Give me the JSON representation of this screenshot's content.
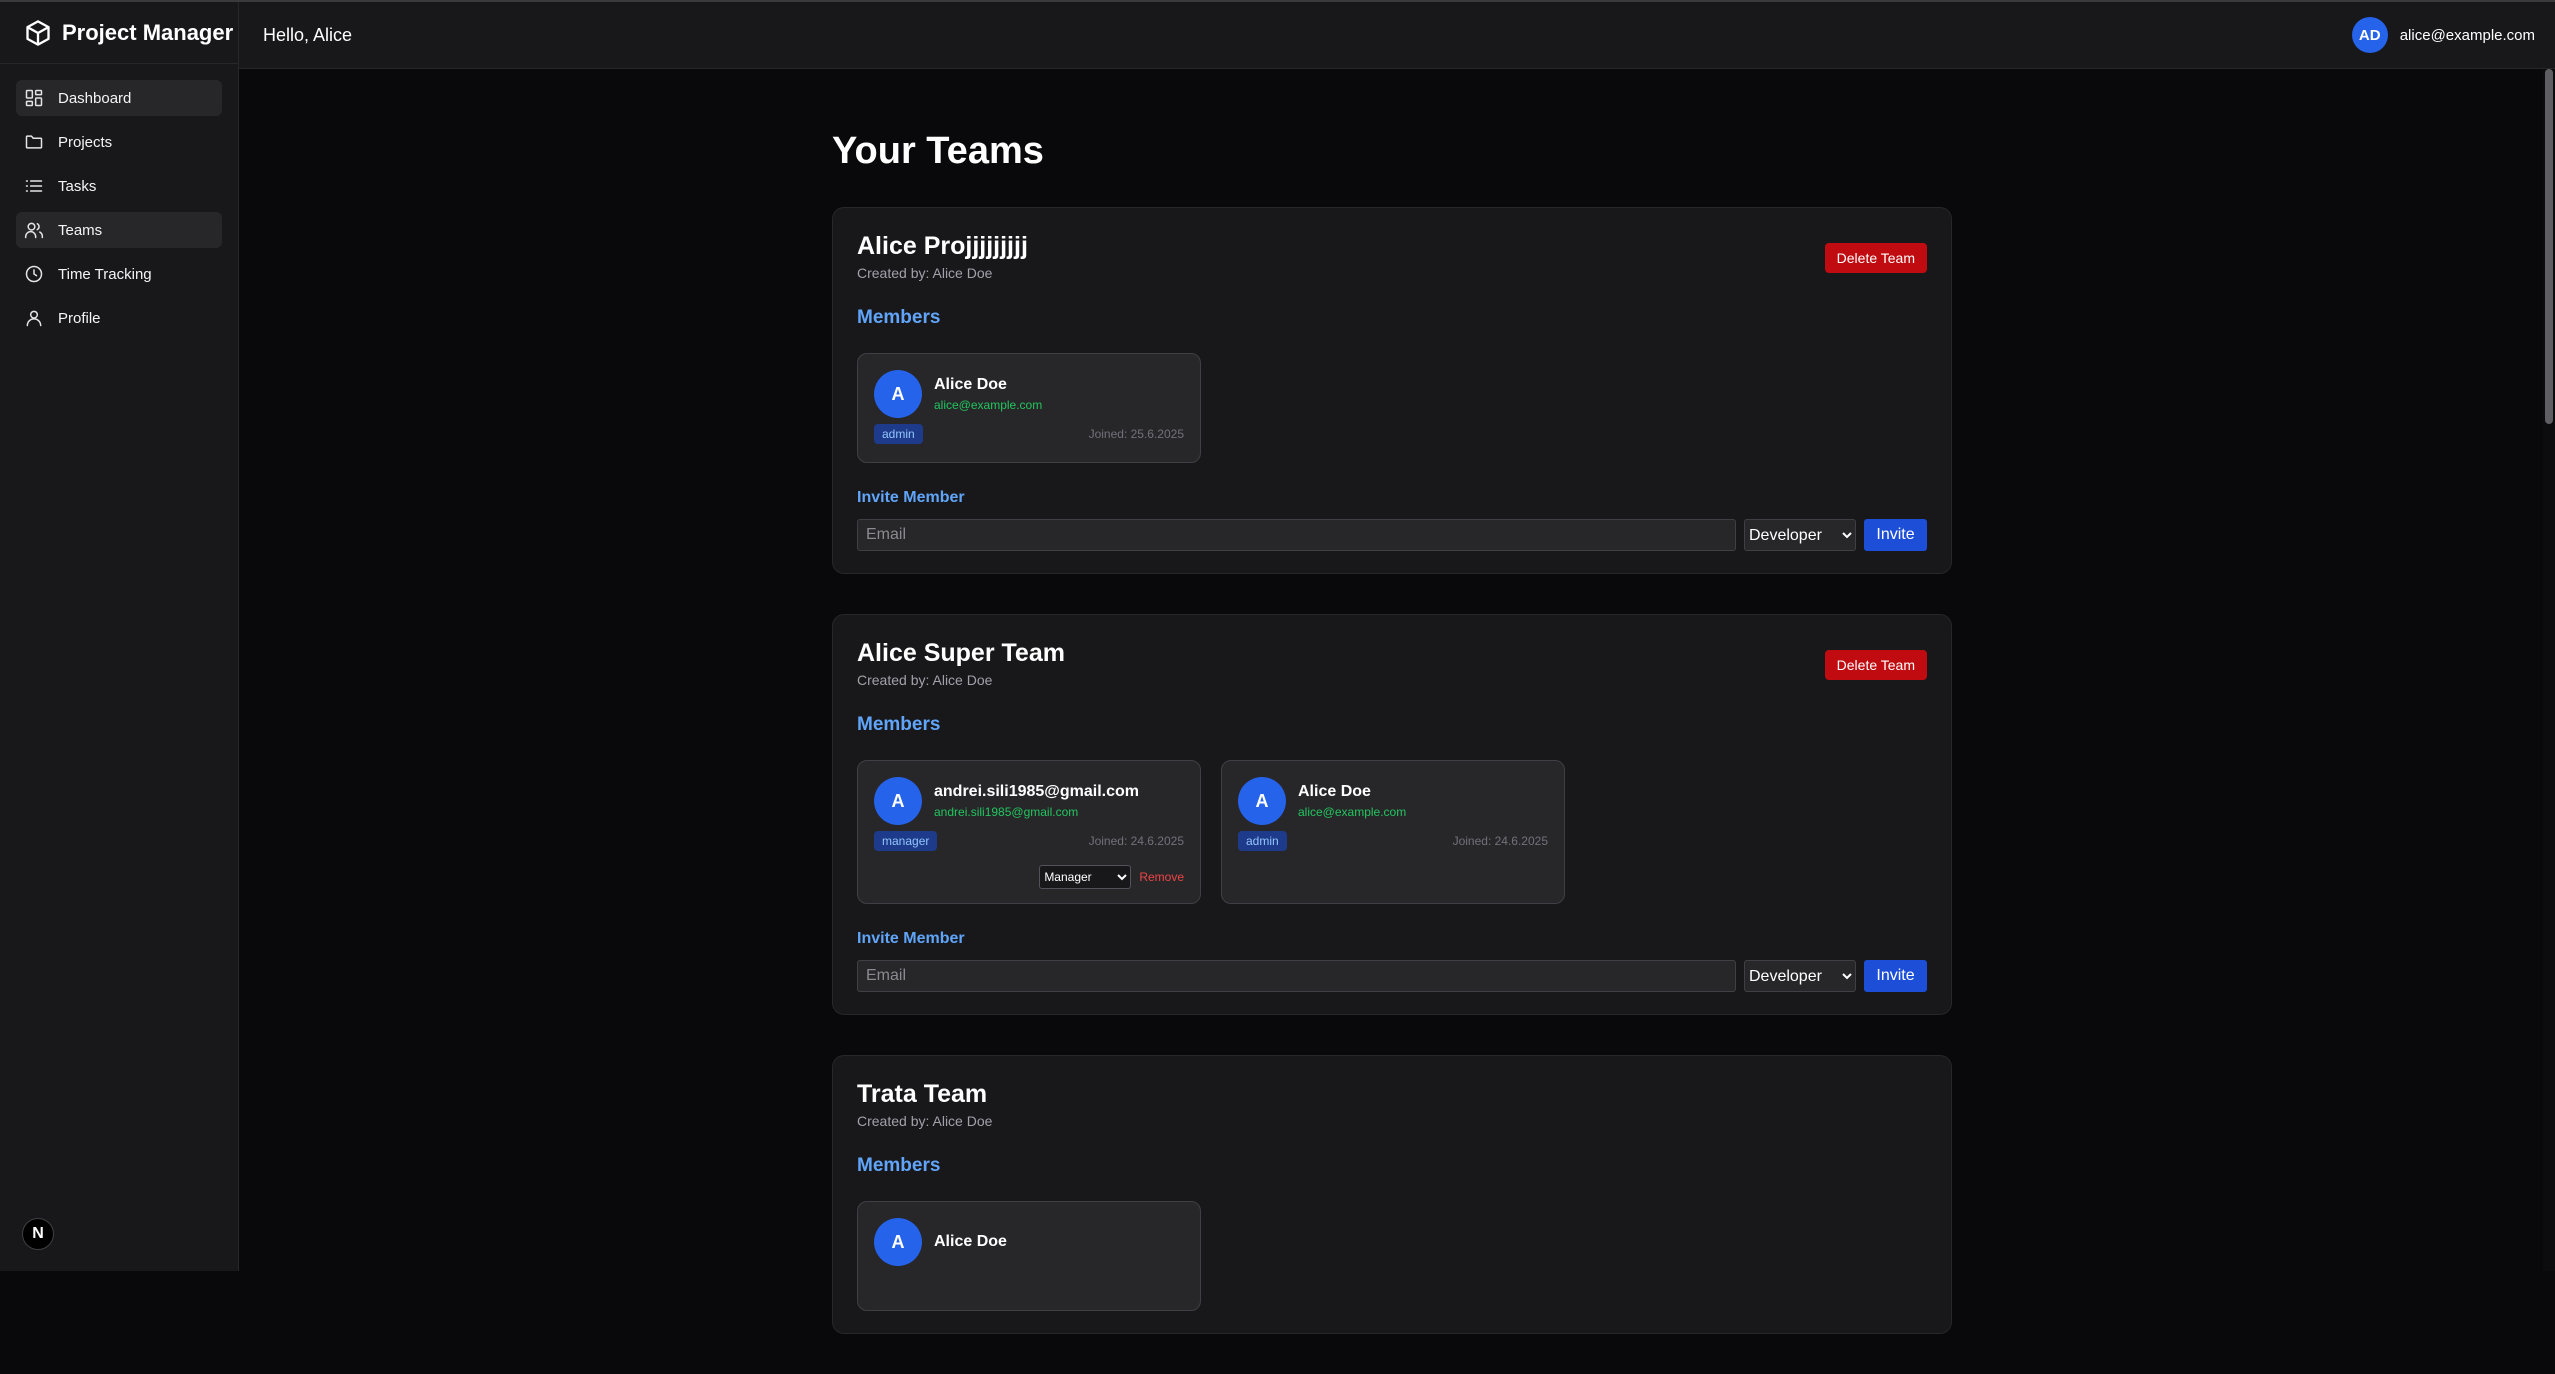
{
  "app": {
    "title": "Project Manager"
  },
  "sidebar": {
    "items": [
      {
        "label": "Dashboard",
        "icon": "dashboard-icon",
        "active": true
      },
      {
        "label": "Projects",
        "icon": "folder-icon",
        "active": false
      },
      {
        "label": "Tasks",
        "icon": "list-icon",
        "active": false
      },
      {
        "label": "Teams",
        "icon": "users-icon",
        "active": true
      },
      {
        "label": "Time Tracking",
        "icon": "clock-icon",
        "active": false
      },
      {
        "label": "Profile",
        "icon": "user-icon",
        "active": false
      }
    ],
    "next_badge": "N"
  },
  "header": {
    "greeting": "Hello, Alice",
    "avatar_initials": "AD",
    "user_email": "alice@example.com"
  },
  "main": {
    "title": "Your Teams",
    "teams": [
      {
        "name": "Alice Projjjjjjjjj",
        "created_by": "Created by: Alice Doe",
        "delete_label": "Delete Team",
        "members_label": "Members",
        "members": [
          {
            "initial": "A",
            "name": "Alice Doe",
            "email": "alice@example.com",
            "role": "admin",
            "joined": "Joined: 25.6.2025"
          }
        ],
        "invite_label": "Invite Member",
        "invite_placeholder": "Email",
        "invite_role": "Developer",
        "invite_button": "Invite"
      },
      {
        "name": "Alice Super Team",
        "created_by": "Created by: Alice Doe",
        "delete_label": "Delete Team",
        "members_label": "Members",
        "members": [
          {
            "initial": "A",
            "name": "andrei.sili1985@gmail.com",
            "email": "andrei.sili1985@gmail.com",
            "role": "manager",
            "joined": "Joined: 24.6.2025",
            "role_select": "Manager",
            "remove_label": "Remove"
          },
          {
            "initial": "A",
            "name": "Alice Doe",
            "email": "alice@example.com",
            "role": "admin",
            "joined": "Joined: 24.6.2025"
          }
        ],
        "invite_label": "Invite Member",
        "invite_placeholder": "Email",
        "invite_role": "Developer",
        "invite_button": "Invite"
      },
      {
        "name": "Trata Team",
        "created_by": "Created by: Alice Doe",
        "members_label": "Members",
        "members": [
          {
            "initial": "A",
            "name": "Alice Doe"
          }
        ]
      }
    ]
  },
  "colors": {
    "background": "#09090b",
    "panel": "#18181b",
    "accent": "#2563eb",
    "danger": "#c00c10",
    "link": "#60a5fa",
    "email": "#22c55e"
  }
}
